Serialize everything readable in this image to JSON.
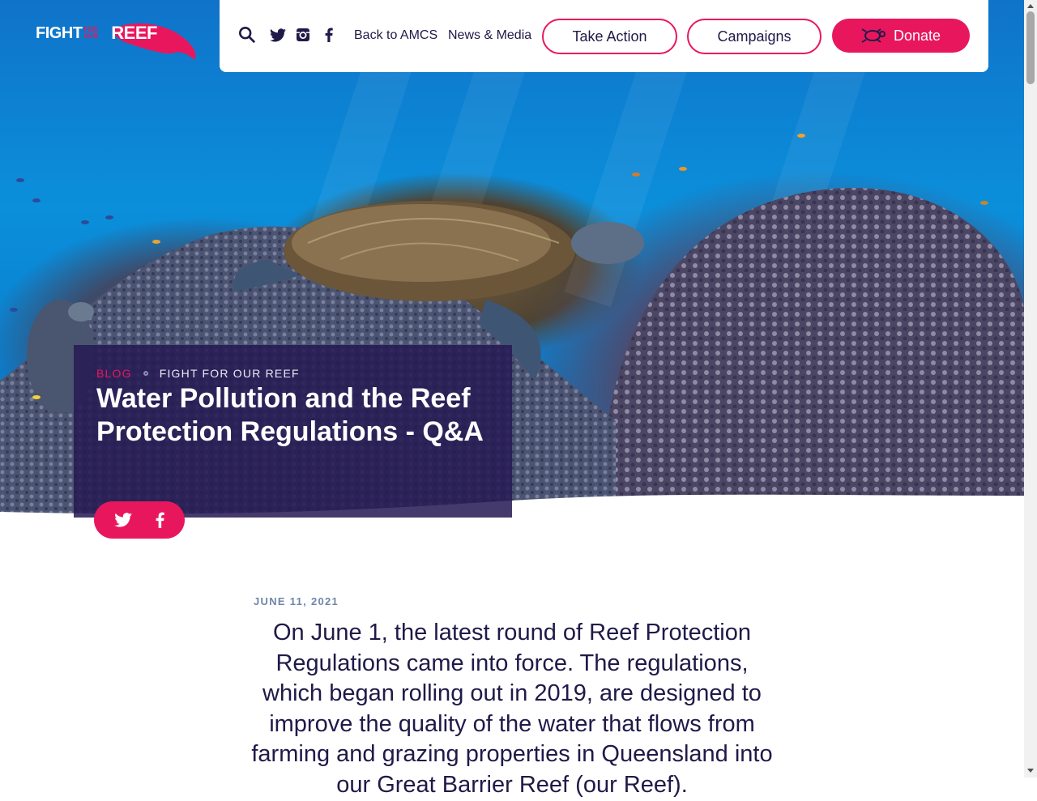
{
  "logo": {
    "fight": "FIGHT",
    "for": "FOR",
    "our": "OUR",
    "reef": "REEF"
  },
  "header": {
    "icons": [
      "search-icon",
      "twitter-icon",
      "instagram-icon",
      "facebook-icon"
    ],
    "back_link": "Back to AMCS",
    "news_link": "News & Media",
    "take_action": "Take Action",
    "campaigns": "Campaigns",
    "donate": "Donate"
  },
  "hero": {
    "crumb_blog": "BLOG",
    "crumb_category": "FIGHT FOR OUR REEF",
    "title": "Water Pollution and the Reef Protection Regulations - Q&A"
  },
  "share": [
    "twitter-icon",
    "facebook-icon"
  ],
  "article": {
    "date": "JUNE 11, 2021",
    "lead": "On June 1, the latest round of Reef Protection Regulations came into force. The regulations, which began rolling out in 2019, are designed to improve the quality of the water that flows from farming and grazing properties in Queensland into our Great Barrier Reef (our Reef)."
  },
  "colors": {
    "accent": "#e8175d",
    "navy": "#1f1a48",
    "card": "#261a54",
    "date": "#6f87a8"
  }
}
